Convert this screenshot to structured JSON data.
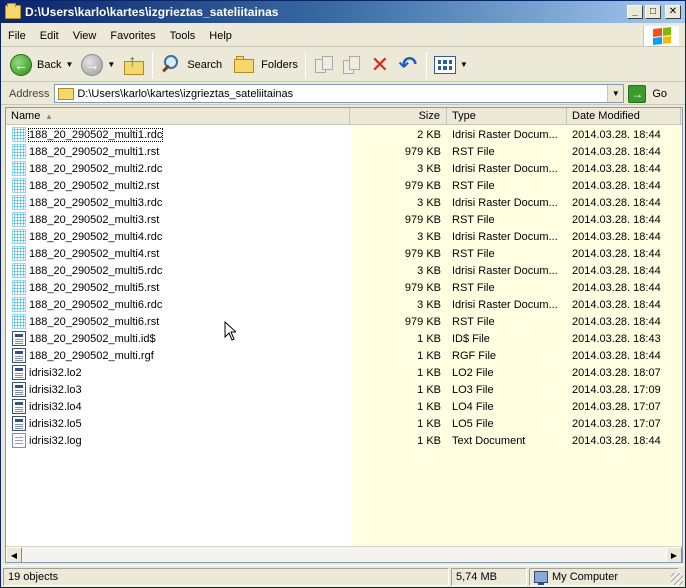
{
  "window": {
    "title": "D:\\Users\\karlo\\kartes\\izgrieztas_sateliitainas",
    "controls": {
      "minimize": "_",
      "maximize": "□",
      "close": "✕"
    }
  },
  "menu": [
    "File",
    "Edit",
    "View",
    "Favorites",
    "Tools",
    "Help"
  ],
  "toolbar": {
    "back_label": "Back",
    "search_label": "Search",
    "folders_label": "Folders"
  },
  "address": {
    "label": "Address",
    "path": "D:\\Users\\karlo\\kartes\\izgrieztas_sateliitainas",
    "go_label": "Go"
  },
  "columns": {
    "name": "Name",
    "size": "Size",
    "type": "Type",
    "date": "Date Modified"
  },
  "files": [
    {
      "name": "188_20_290502_multi1.rdc",
      "size": "2 KB",
      "type": "Idrisi Raster Docum...",
      "date": "2014.03.28.  18:44",
      "icon": "raster-file-icon"
    },
    {
      "name": "188_20_290502_multi1.rst",
      "size": "979 KB",
      "type": "RST File",
      "date": "2014.03.28.  18:44",
      "icon": "raster-file-icon"
    },
    {
      "name": "188_20_290502_multi2.rdc",
      "size": "3 KB",
      "type": "Idrisi Raster Docum...",
      "date": "2014.03.28.  18:44",
      "icon": "raster-file-icon"
    },
    {
      "name": "188_20_290502_multi2.rst",
      "size": "979 KB",
      "type": "RST File",
      "date": "2014.03.28.  18:44",
      "icon": "raster-file-icon"
    },
    {
      "name": "188_20_290502_multi3.rdc",
      "size": "3 KB",
      "type": "Idrisi Raster Docum...",
      "date": "2014.03.28.  18:44",
      "icon": "raster-file-icon"
    },
    {
      "name": "188_20_290502_multi3.rst",
      "size": "979 KB",
      "type": "RST File",
      "date": "2014.03.28.  18:44",
      "icon": "raster-file-icon"
    },
    {
      "name": "188_20_290502_multi4.rdc",
      "size": "3 KB",
      "type": "Idrisi Raster Docum...",
      "date": "2014.03.28.  18:44",
      "icon": "raster-file-icon"
    },
    {
      "name": "188_20_290502_multi4.rst",
      "size": "979 KB",
      "type": "RST File",
      "date": "2014.03.28.  18:44",
      "icon": "raster-file-icon"
    },
    {
      "name": "188_20_290502_multi5.rdc",
      "size": "3 KB",
      "type": "Idrisi Raster Docum...",
      "date": "2014.03.28.  18:44",
      "icon": "raster-file-icon"
    },
    {
      "name": "188_20_290502_multi5.rst",
      "size": "979 KB",
      "type": "RST File",
      "date": "2014.03.28.  18:44",
      "icon": "raster-file-icon"
    },
    {
      "name": "188_20_290502_multi6.rdc",
      "size": "3 KB",
      "type": "Idrisi Raster Docum...",
      "date": "2014.03.28.  18:44",
      "icon": "raster-file-icon"
    },
    {
      "name": "188_20_290502_multi6.rst",
      "size": "979 KB",
      "type": "RST File",
      "date": "2014.03.28.  18:44",
      "icon": "raster-file-icon"
    },
    {
      "name": "188_20_290502_multi.id$",
      "size": "1 KB",
      "type": "ID$ File",
      "date": "2014.03.28.  18:43",
      "icon": "document-file-icon"
    },
    {
      "name": "188_20_290502_multi.rgf",
      "size": "1 KB",
      "type": "RGF File",
      "date": "2014.03.28.  18:44",
      "icon": "document-file-icon"
    },
    {
      "name": "idrisi32.lo2",
      "size": "1 KB",
      "type": "LO2 File",
      "date": "2014.03.28.  18:07",
      "icon": "document-file-icon"
    },
    {
      "name": "idrisi32.lo3",
      "size": "1 KB",
      "type": "LO3 File",
      "date": "2014.03.28.  17:09",
      "icon": "document-file-icon"
    },
    {
      "name": "idrisi32.lo4",
      "size": "1 KB",
      "type": "LO4 File",
      "date": "2014.03.28.  17:07",
      "icon": "document-file-icon"
    },
    {
      "name": "idrisi32.lo5",
      "size": "1 KB",
      "type": "LO5 File",
      "date": "2014.03.28.  17:07",
      "icon": "document-file-icon"
    },
    {
      "name": "idrisi32.log",
      "size": "1 KB",
      "type": "Text Document",
      "date": "2014.03.28.  18:44",
      "icon": "text-file-icon"
    }
  ],
  "status": {
    "objects": "19 objects",
    "total_size": "5,74 MB",
    "zone": "My Computer"
  },
  "colors": {
    "title_bar_start": "#0a246a",
    "sorted_column_shade": "#fefee0",
    "raster_icon": "#2bb2d8"
  }
}
